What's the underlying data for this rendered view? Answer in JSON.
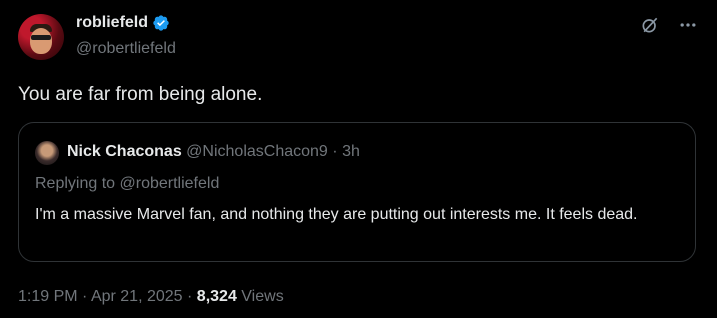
{
  "tweet": {
    "author": {
      "display_name": "robliefeld",
      "handle": "@robertliefeld",
      "verified": true
    },
    "text": "You are far from being alone.",
    "timestamp": "1:19 PM",
    "date": "Apr 21, 2025",
    "separator": "·",
    "views_count": "8,324",
    "views_label": "Views"
  },
  "quote": {
    "author_name": "Nick Chaconas",
    "author_handle": "@NicholasChacon9",
    "separator": "·",
    "time": "3h",
    "replying_to": "Replying to @robertliefeld",
    "text": "I'm a massive Marvel fan, and nothing they are putting out interests me. It feels dead."
  },
  "colors": {
    "background": "#000000",
    "text": "#e7e9ea",
    "muted": "#71767b",
    "verified": "#1d9bf0",
    "border": "#2f3336"
  },
  "icons": [
    "verified-badge-icon",
    "grok-icon",
    "more-options-icon"
  ]
}
